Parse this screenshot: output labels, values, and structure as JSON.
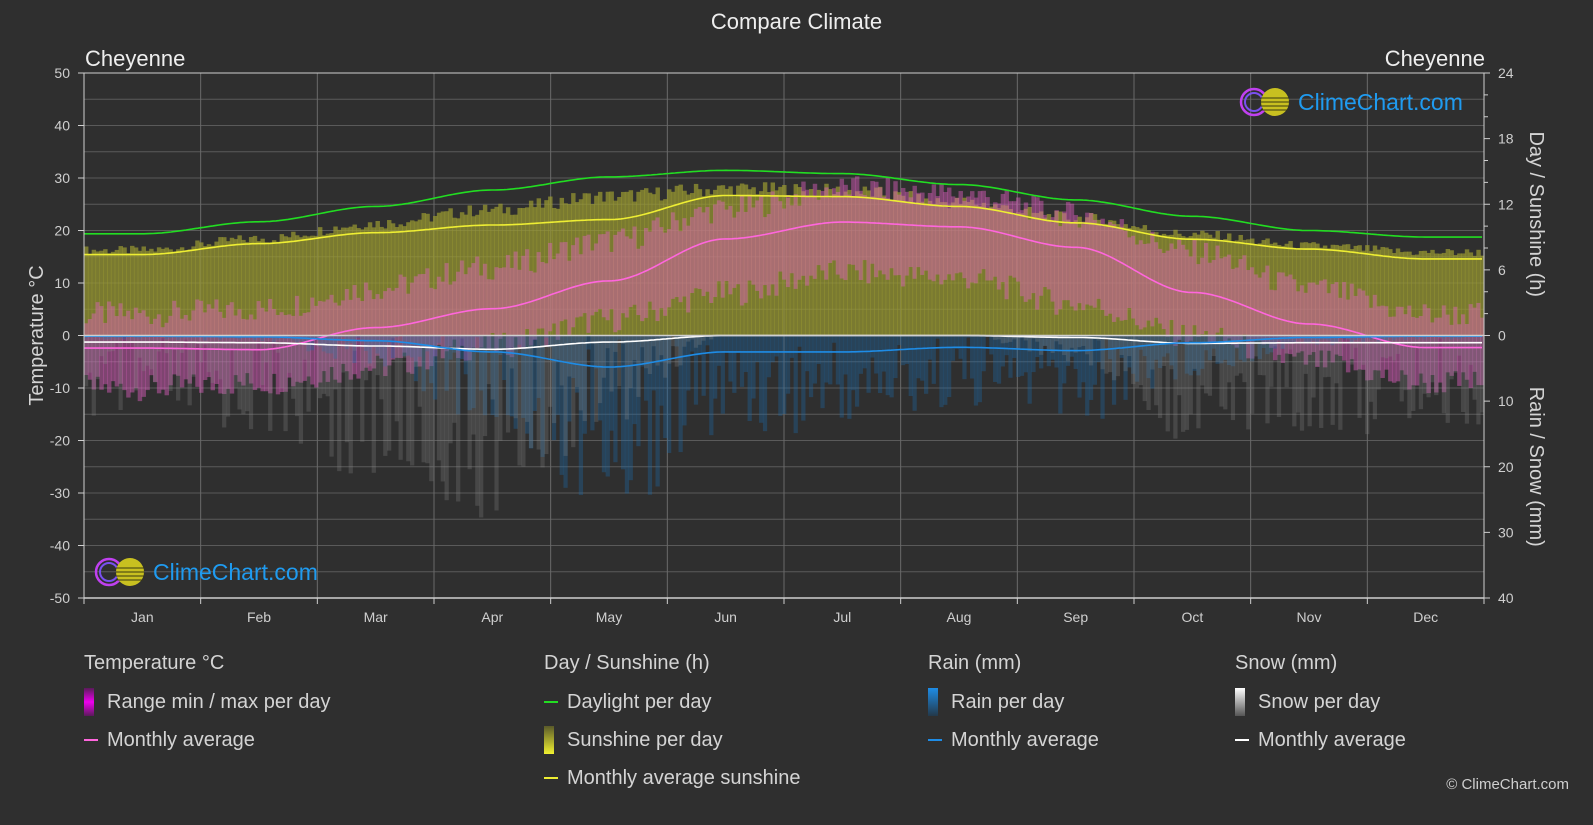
{
  "title": "Compare Climate",
  "city_left": "Cheyenne",
  "city_right": "Cheyenne",
  "logo_text": "ClimeChart.com",
  "copyright": "© ClimeChart.com",
  "colors": {
    "background": "#2f2f2f",
    "daylight": "#22dd22",
    "sunshine_avg": "#eeee33",
    "sunshine_fill": "#9a9a30",
    "temp_avg": "#ff66dd",
    "temp_range": "#dd00dd",
    "rain": "#1e8ce6",
    "snow": "#ffffff",
    "grid": "#5a5a5a"
  },
  "legend": {
    "temperature": {
      "heading": "Temperature °C",
      "items": [
        {
          "label": "Range min / max per day",
          "kind": "bar"
        },
        {
          "label": "Monthly average",
          "kind": "line"
        }
      ]
    },
    "sunshine": {
      "heading": "Day / Sunshine (h)",
      "items": [
        {
          "label": "Daylight per day",
          "kind": "line"
        },
        {
          "label": "Sunshine per day",
          "kind": "bar"
        },
        {
          "label": "Monthly average sunshine",
          "kind": "line"
        }
      ]
    },
    "rain": {
      "heading": "Rain (mm)",
      "items": [
        {
          "label": "Rain per day",
          "kind": "bar"
        },
        {
          "label": "Monthly average",
          "kind": "line"
        }
      ]
    },
    "snow": {
      "heading": "Snow (mm)",
      "items": [
        {
          "label": "Snow per day",
          "kind": "bar"
        },
        {
          "label": "Monthly average",
          "kind": "line"
        }
      ]
    }
  },
  "chart_data": {
    "type": "line",
    "title": "Compare Climate",
    "categories": [
      "Jan",
      "Feb",
      "Mar",
      "Apr",
      "May",
      "Jun",
      "Jul",
      "Aug",
      "Sep",
      "Oct",
      "Nov",
      "Dec"
    ],
    "axes": {
      "left": {
        "label": "Temperature °C",
        "range": [
          -50,
          50
        ],
        "ticks": [
          50,
          40,
          30,
          20,
          10,
          0,
          -10,
          -20,
          -30,
          -40,
          -50
        ]
      },
      "right_top": {
        "label": "Day / Sunshine (h)",
        "range": [
          0,
          24
        ],
        "ticks": [
          24,
          18,
          12,
          6,
          0
        ]
      },
      "right_bottom": {
        "label": "Rain / Snow (mm)",
        "range": [
          0,
          40
        ],
        "ticks": [
          0,
          10,
          20,
          30,
          40
        ]
      }
    },
    "grid": true,
    "series": [
      {
        "name": "Daylight per day",
        "axis": "right_top",
        "unit": "h",
        "values": [
          9.3,
          10.4,
          11.8,
          13.3,
          14.5,
          15.1,
          14.8,
          13.8,
          12.4,
          10.9,
          9.6,
          9.0
        ]
      },
      {
        "name": "Sunshine per day (max band)",
        "axis": "right_top",
        "unit": "h",
        "values": [
          8.2,
          9.3,
          10.8,
          12.1,
          13.4,
          14.1,
          13.9,
          12.8,
          11.3,
          9.7,
          8.6,
          8.0
        ]
      },
      {
        "name": "Monthly average sunshine",
        "axis": "right_top",
        "unit": "h",
        "values": [
          7.4,
          8.4,
          9.4,
          10.1,
          10.6,
          12.8,
          12.7,
          11.8,
          10.3,
          8.8,
          7.9,
          7.0
        ]
      },
      {
        "name": "Temperature monthly average",
        "axis": "left",
        "unit": "°C",
        "values": [
          -2.4,
          -2.7,
          1.5,
          5.1,
          10.4,
          18.4,
          21.6,
          20.7,
          16.8,
          8.2,
          2.2,
          -2.3
        ]
      },
      {
        "name": "Temperature max per day (avg)",
        "axis": "left",
        "unit": "°C",
        "values": [
          4,
          5,
          9,
          13,
          18,
          24,
          28,
          27,
          23,
          16,
          9,
          4
        ]
      },
      {
        "name": "Temperature min per day (avg)",
        "axis": "left",
        "unit": "°C",
        "values": [
          -10,
          -9,
          -6,
          -2,
          3,
          8,
          12,
          11,
          6,
          0,
          -5,
          -9
        ]
      },
      {
        "name": "Rain monthly average",
        "axis": "right_bottom",
        "unit": "mm",
        "values": [
          0.1,
          0.2,
          0.8,
          2.5,
          4.8,
          2.5,
          2.5,
          1.8,
          2.3,
          1.1,
          0.3,
          0.1
        ]
      },
      {
        "name": "Snow monthly average",
        "axis": "right_bottom",
        "unit": "mm",
        "values": [
          1.0,
          1.1,
          1.6,
          2.1,
          1.0,
          0.0,
          0.0,
          0.0,
          0.3,
          1.2,
          1.1,
          1.1
        ]
      }
    ]
  }
}
